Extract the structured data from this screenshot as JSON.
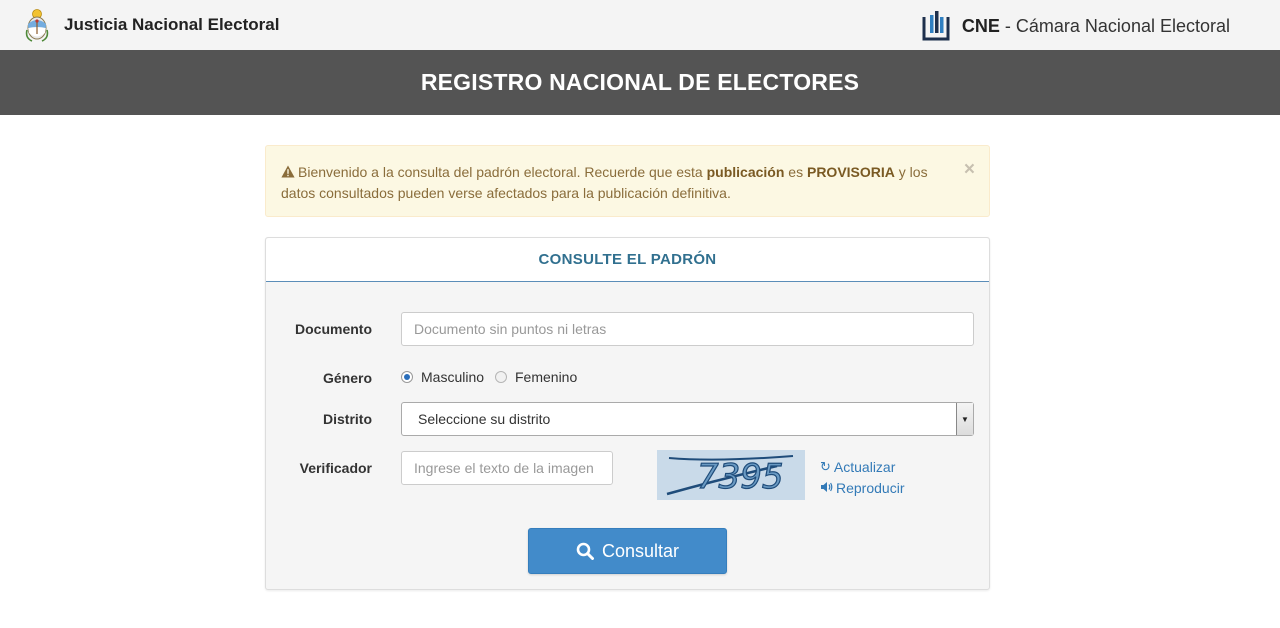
{
  "header": {
    "left_title": "Justicia Nacional Electoral",
    "right_abbr": "CNE",
    "right_sep": " - ",
    "right_title": "Cámara Nacional Electoral"
  },
  "banner": {
    "title": "REGISTRO NACIONAL DE ELECTORES"
  },
  "alert": {
    "text_1": "Bienvenido a la consulta del padrón electoral. Recuerde que esta ",
    "bold_1": "publicación",
    "text_2": " es ",
    "bold_2": "PROVISORIA",
    "text_3": " y los datos consultados pueden verse afectados para la publicación definitiva.",
    "close": "×"
  },
  "form": {
    "title": "CONSULTE EL PADRÓN",
    "documento_label": "Documento",
    "documento_placeholder": "Documento sin puntos ni letras",
    "genero_label": "Género",
    "genero_options": [
      "Masculino",
      "Femenino"
    ],
    "genero_selected": "Masculino",
    "distrito_label": "Distrito",
    "distrito_value": "Seleccione su distrito",
    "verificador_label": "Verificador",
    "verificador_placeholder": "Ingrese el texto de la imagen",
    "captcha_text": "7395",
    "refresh_label": "Actualizar",
    "audio_label": "Reproducir",
    "submit_label": "Consultar"
  },
  "colors": {
    "band": "#545454",
    "alert_bg": "#fcf8e3",
    "panel_title": "#31708f",
    "button": "#428bca",
    "link": "#337ab7"
  },
  "icons": [
    "argentina-coat-of-arms-icon",
    "cne-logo-icon",
    "warning-icon",
    "close-icon",
    "refresh-icon",
    "volume-icon",
    "search-icon",
    "chevron-down-icon"
  ]
}
